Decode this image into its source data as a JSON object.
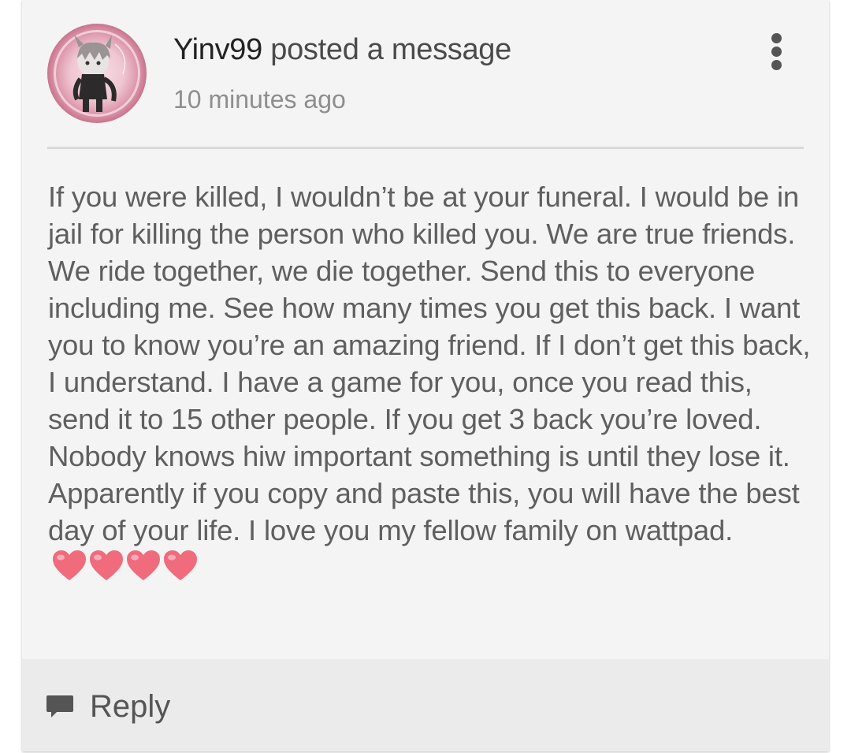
{
  "post": {
    "username": "Yinv99",
    "action_text": " posted a message",
    "timestamp": "10 minutes ago",
    "menu_icon": "more-vertical-icon",
    "avatar_icon": "user-avatar"
  },
  "message": {
    "text": "If you were killed, I wouldn’t be at your funeral. I would be in jail for killing the person who killed you. We are true friends. We ride together, we die together. Send this to everyone including me. See how many times you get this back. I want you to know you’re an amazing friend. If I don’t get this back, I understand. I have a game for you, once you read this, send it to 15 other people. If you get 3 back you’re loved. Nobody knows hiw important something is until they lose it. Apparently if you copy and paste this, you will have the best day of your life. I love you my fellow family on wattpad.",
    "emoji": [
      "heart",
      "heart",
      "heart",
      "heart"
    ],
    "emoji_color": "#f06b7c"
  },
  "footer": {
    "reply_label": "Reply",
    "reply_icon": "comment-icon"
  },
  "colors": {
    "card_bg": "#f4f4f4",
    "footer_bg": "#ebebeb",
    "text": "#5f5f5f",
    "username": "#222222",
    "timestamp": "#8e8e8e"
  }
}
